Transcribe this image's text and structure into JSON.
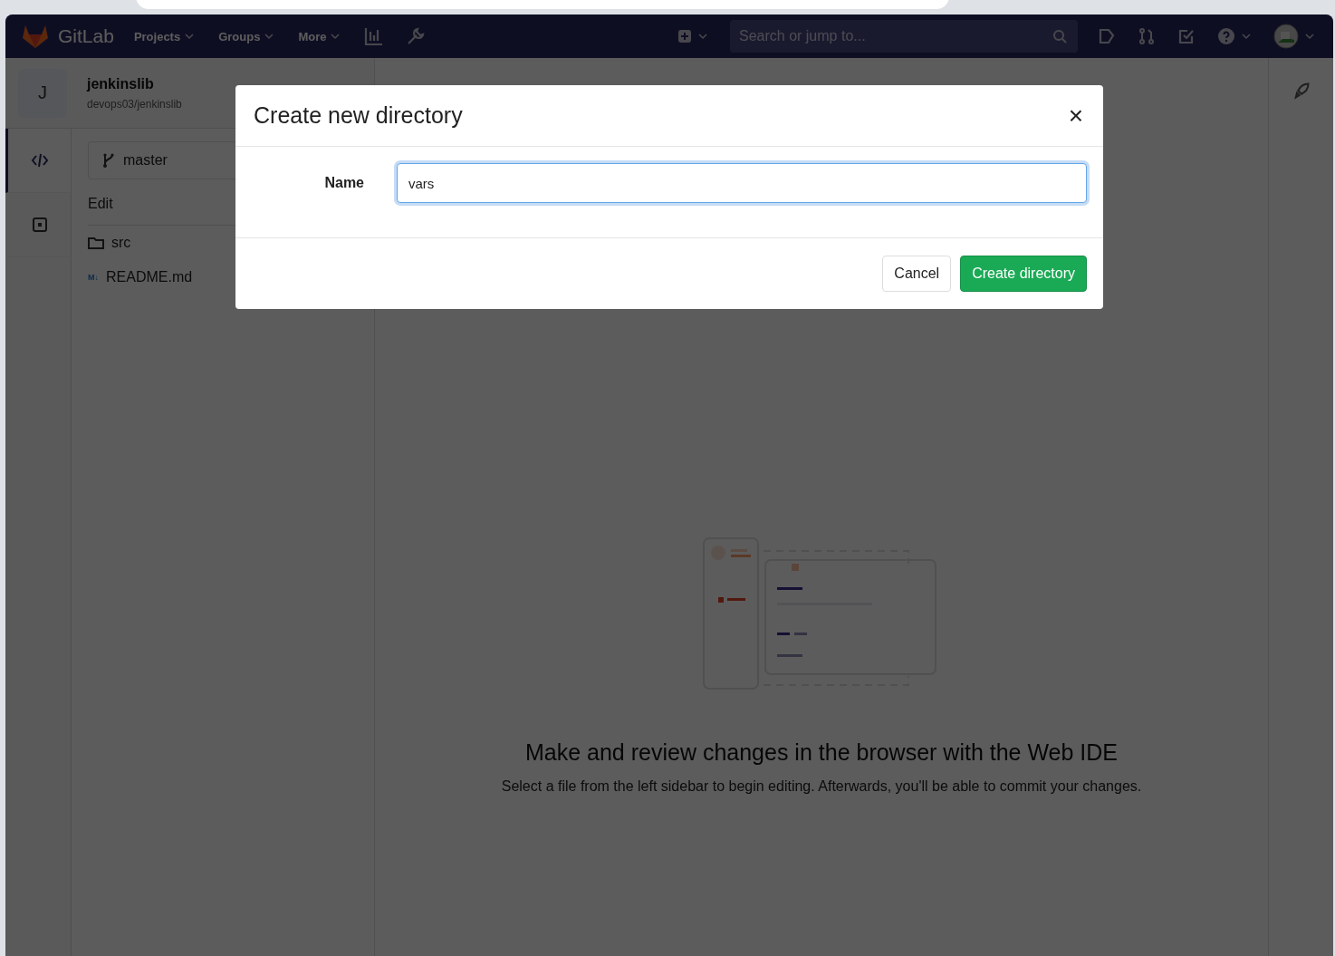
{
  "navbar": {
    "logo": "GitLab",
    "menus": [
      {
        "label": "Projects"
      },
      {
        "label": "Groups"
      },
      {
        "label": "More"
      }
    ],
    "search": {
      "placeholder": "Search or jump to..."
    }
  },
  "project": {
    "avatar": "J",
    "name": "jenkinslib",
    "path": "devops03/jenkinslib"
  },
  "activity_bar": [
    {
      "kind": "code",
      "selected": true
    },
    {
      "kind": "commit",
      "selected": false
    }
  ],
  "file_panel": {
    "branch": "master",
    "heading": "Edit",
    "files": [
      {
        "kind": "folder",
        "name": "src"
      },
      {
        "kind": "markdown",
        "badge": "M↓",
        "name": "README.md"
      }
    ]
  },
  "empty_state": {
    "title": "Make and review changes in the browser with the Web IDE",
    "text": "Select a file from the left sidebar to begin editing. Afterwards, you'll be able to commit your changes."
  },
  "modal": {
    "title": "Create new directory",
    "close": "×",
    "field_label": "Name",
    "value": "vars",
    "buttons": [
      {
        "kind": "secondary",
        "label": "Cancel"
      },
      {
        "kind": "primary",
        "label": "Create directory"
      }
    ]
  }
}
